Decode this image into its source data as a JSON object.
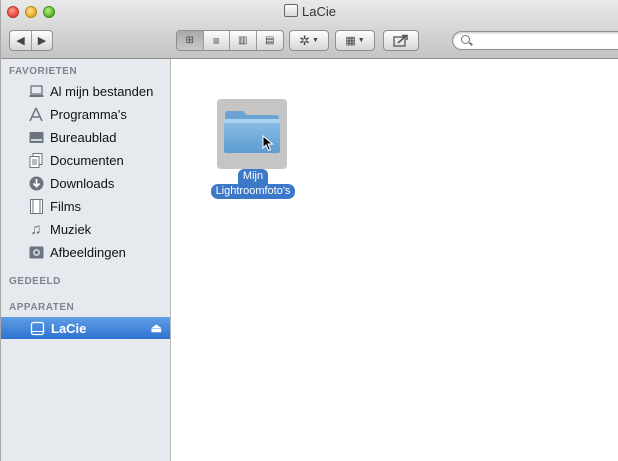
{
  "window": {
    "title": "LaCie"
  },
  "toolbar": {
    "back_icon": "back-arrow-icon",
    "forward_icon": "forward-arrow-icon",
    "view_modes": [
      "icon-view",
      "list-view",
      "column-view",
      "coverflow-view"
    ],
    "active_view": "icon-view",
    "action_icon": "gear-icon",
    "arrange_icon": "arrange-grid-icon",
    "share_icon": "share-icon",
    "search": {
      "value": "",
      "placeholder": ""
    }
  },
  "sidebar": {
    "sections": {
      "favorites": "FAVORIETEN",
      "shared": "GEDEELD",
      "devices": "APPARATEN"
    },
    "favorites": [
      {
        "label": "Al mijn bestanden",
        "icon": "all-files-icon"
      },
      {
        "label": "Programma's",
        "icon": "applications-icon"
      },
      {
        "label": "Bureaublad",
        "icon": "desktop-icon"
      },
      {
        "label": "Documenten",
        "icon": "documents-icon"
      },
      {
        "label": "Downloads",
        "icon": "downloads-icon"
      },
      {
        "label": "Films",
        "icon": "movies-icon"
      },
      {
        "label": "Muziek",
        "icon": "music-icon"
      },
      {
        "label": "Afbeeldingen",
        "icon": "pictures-icon"
      }
    ],
    "devices": [
      {
        "label": "LaCie",
        "icon": "drive-icon",
        "selected": true
      }
    ]
  },
  "content": {
    "items": [
      {
        "name_line1": "Mijn",
        "name_line2": "Lightroomfoto's",
        "type": "folder",
        "selected": true
      }
    ]
  },
  "colors": {
    "selection": "#3c78c8",
    "sidebar_bg": "#e6eaef"
  }
}
